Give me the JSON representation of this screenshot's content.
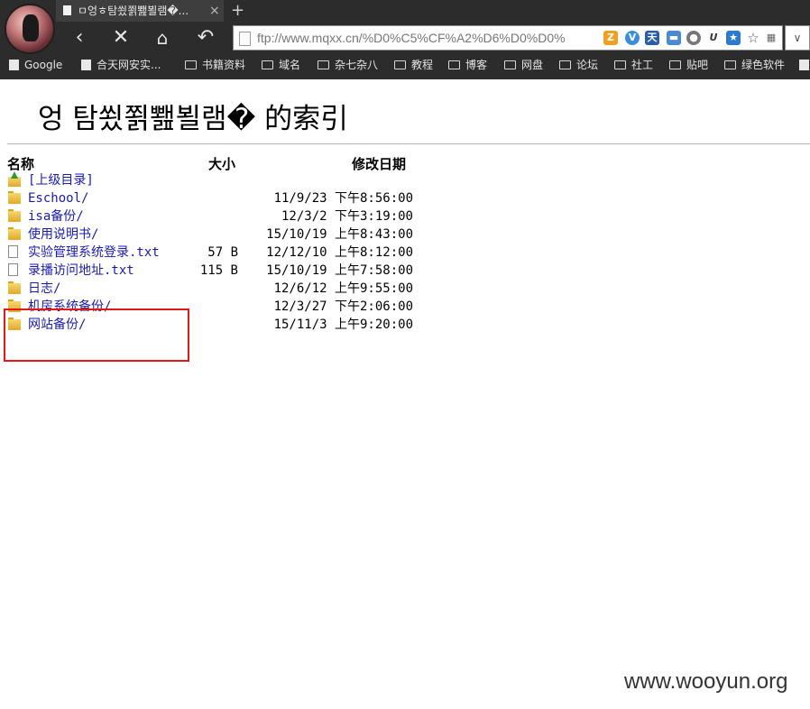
{
  "browser": {
    "tab_title": "ㅁ엉ㅎ탐쑀쬙뾆뵐램�...",
    "tab_close": "×",
    "new_tab": "+",
    "address": "ftp://www.mqxx.cn/%D0%C5%CF%A2%D6%D0%D0%",
    "bookmarks": [
      "Google",
      "合天网安实...",
      "书籍资料",
      "域名",
      "杂七杂八",
      "教程",
      "博客",
      "网盘",
      "论坛",
      "社工",
      "贴吧",
      "绿色软件"
    ]
  },
  "page": {
    "heading": "엉  탐쑀쬙뾆뵐램� 的索引",
    "columns": {
      "name": "名称",
      "size": "大小",
      "date": "修改日期"
    },
    "entries": [
      {
        "name": "[上级目录]",
        "size": "",
        "date": "",
        "icon": "up-folder-icon"
      },
      {
        "name": "Eschool/",
        "size": "",
        "date": "11/9/23 下午8:56:00",
        "icon": "folder-icon"
      },
      {
        "name": "isa备份/",
        "size": "",
        "date": "12/3/2 下午3:19:00",
        "icon": "folder-icon"
      },
      {
        "name": "使用说明书/",
        "size": "",
        "date": "15/10/19 上午8:43:00",
        "icon": "folder-icon"
      },
      {
        "name": "实验管理系统登录.txt",
        "size": "57 B",
        "date": "12/12/10 上午8:12:00",
        "icon": "file-icon"
      },
      {
        "name": "录播访问地址.txt",
        "size": "115 B",
        "date": "15/10/19 上午7:58:00",
        "icon": "file-icon"
      },
      {
        "name": "日志/",
        "size": "",
        "date": "12/6/12 上午9:55:00",
        "icon": "folder-icon"
      },
      {
        "name": "机房系统备份/",
        "size": "",
        "date": "12/3/27 下午2:06:00",
        "icon": "folder-icon"
      },
      {
        "name": "网站备份/",
        "size": "",
        "date": "15/11/3 上午9:20:00",
        "icon": "folder-icon"
      }
    ]
  },
  "watermark": "www.wooyun.org",
  "colors": {
    "link": "#1a1ab0",
    "highlight_box": "#e01818",
    "chrome_bg": "#2c2c2c"
  }
}
